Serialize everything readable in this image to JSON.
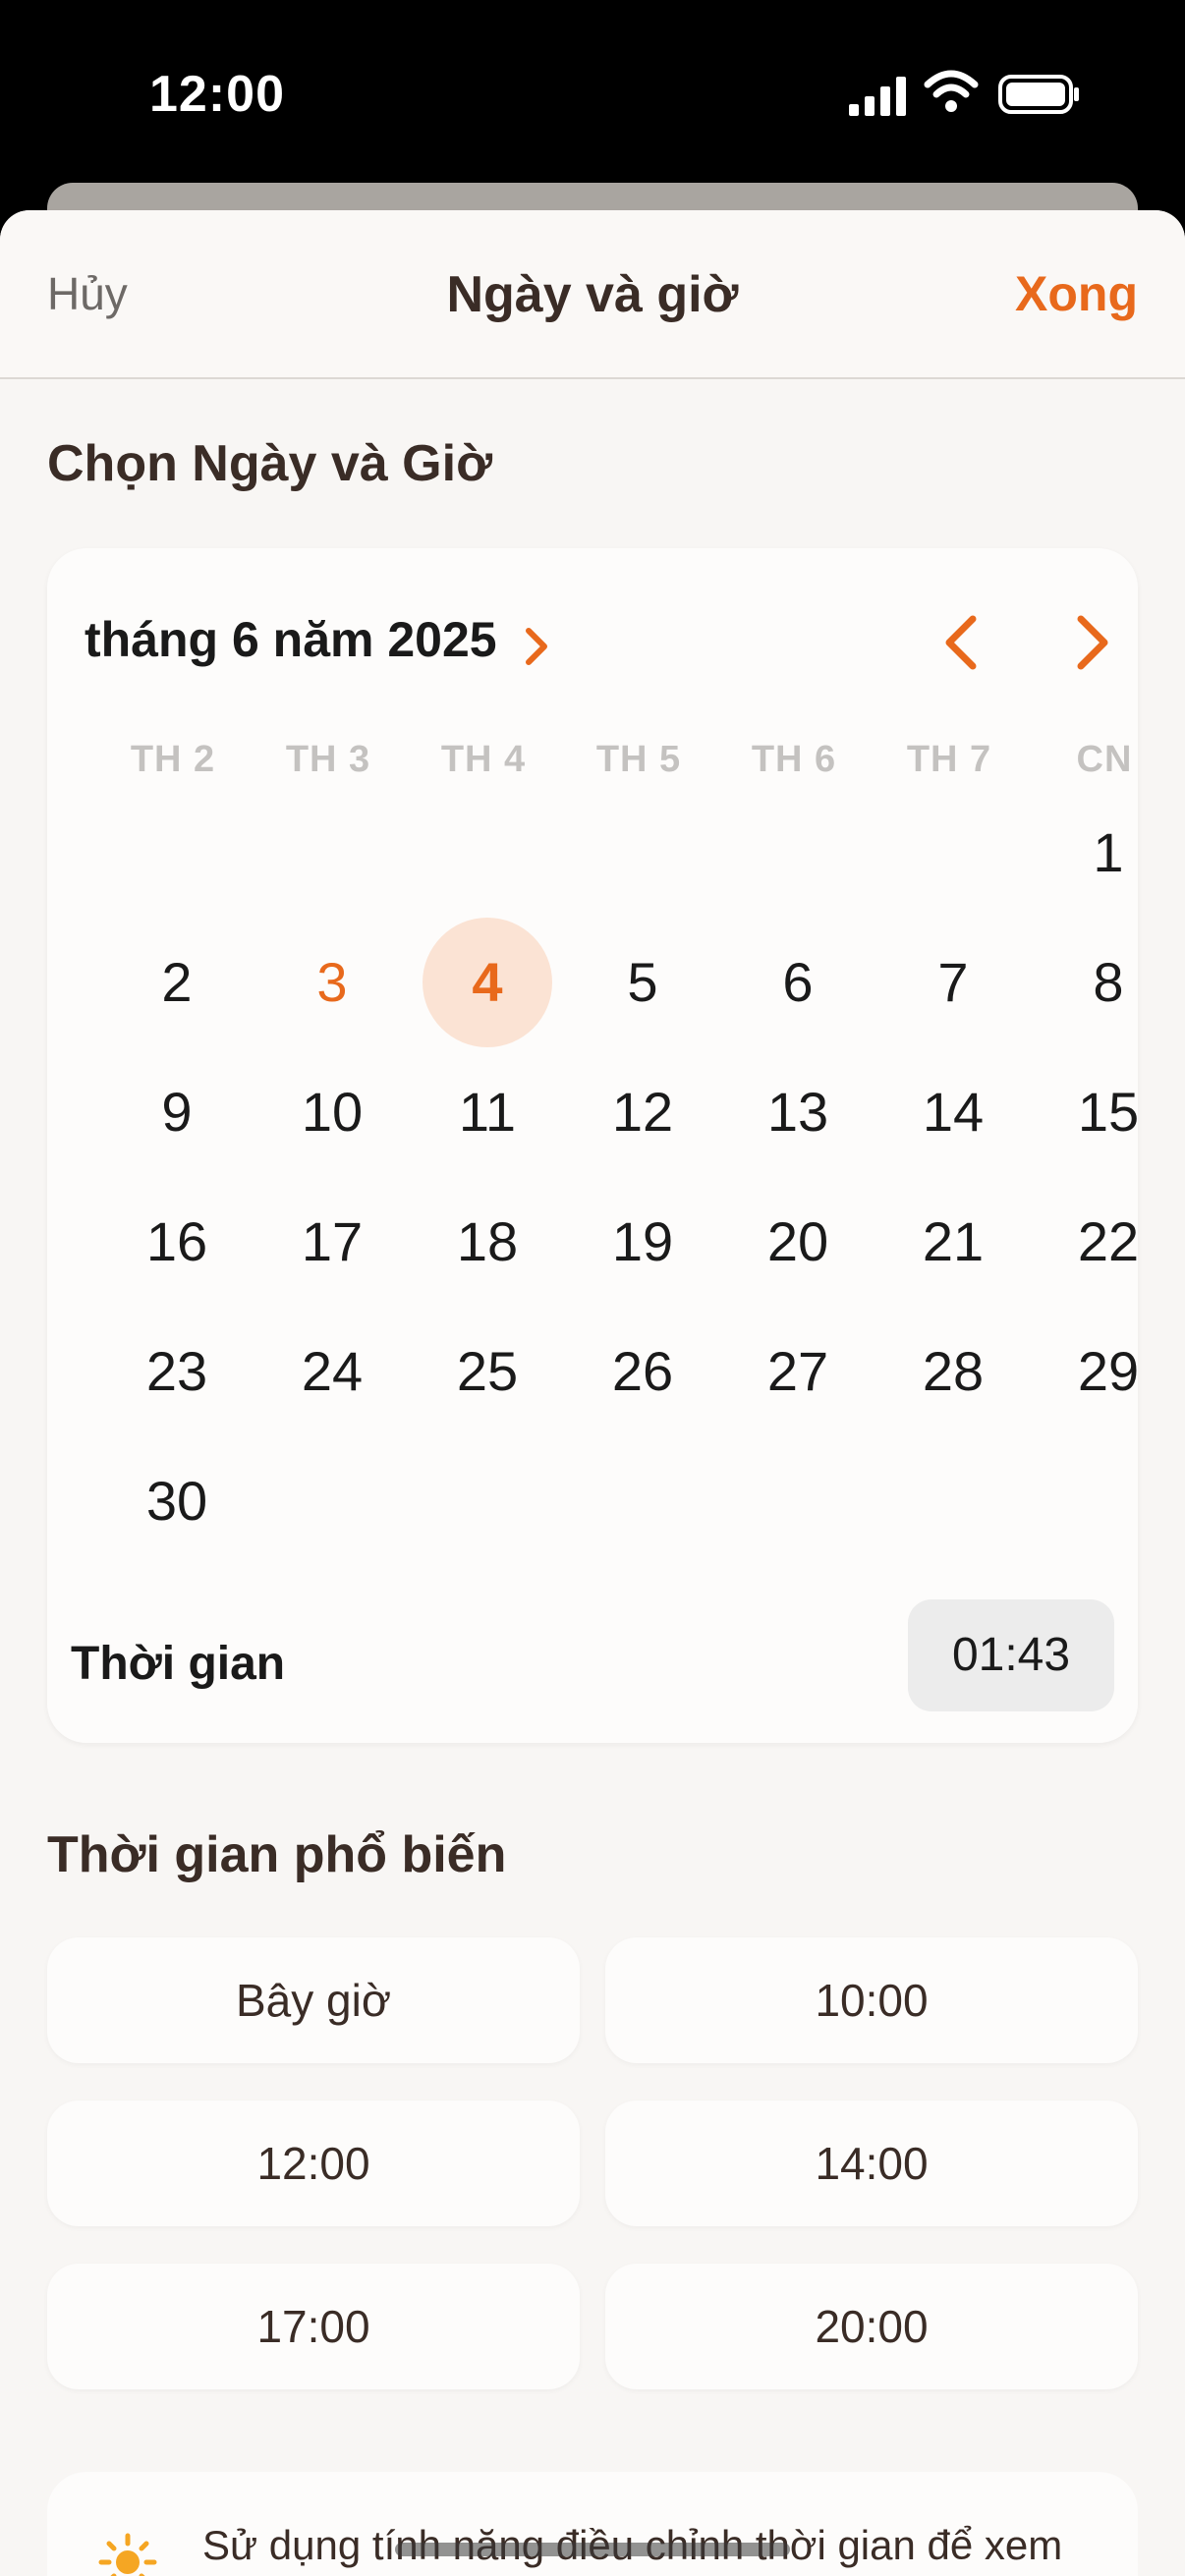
{
  "status_bar": {
    "time": "12:00"
  },
  "nav": {
    "cancel": "Hủy",
    "title": "Ngày và giờ",
    "done": "Xong"
  },
  "picker": {
    "section_title": "Chọn Ngày và Giờ",
    "month_label": "tháng 6 năm 2025",
    "weekdays": [
      "TH 2",
      "TH 3",
      "TH 4",
      "TH 5",
      "TH 6",
      "TH 7",
      "CN"
    ],
    "days": [
      "1",
      "2",
      "3",
      "4",
      "5",
      "6",
      "7",
      "8",
      "9",
      "10",
      "11",
      "12",
      "13",
      "14",
      "15",
      "16",
      "17",
      "18",
      "19",
      "20",
      "21",
      "22",
      "23",
      "24",
      "25",
      "26",
      "27",
      "28",
      "29",
      "30"
    ],
    "today_day": "3",
    "selected_day": "4",
    "time_label": "Thời gian",
    "time_value": "01:43"
  },
  "popular": {
    "title": "Thời gian phổ biến",
    "options": [
      "Bây giờ",
      "10:00",
      "12:00",
      "14:00",
      "17:00",
      "20:00"
    ]
  },
  "info": {
    "text": "Sử dụng tính năng điều chỉnh thời gian để xem"
  },
  "colors": {
    "accent": "#e8691c",
    "selected_bg": "#fbe3d4",
    "background": "#f8f6f4",
    "card": "#fdfcfb"
  }
}
